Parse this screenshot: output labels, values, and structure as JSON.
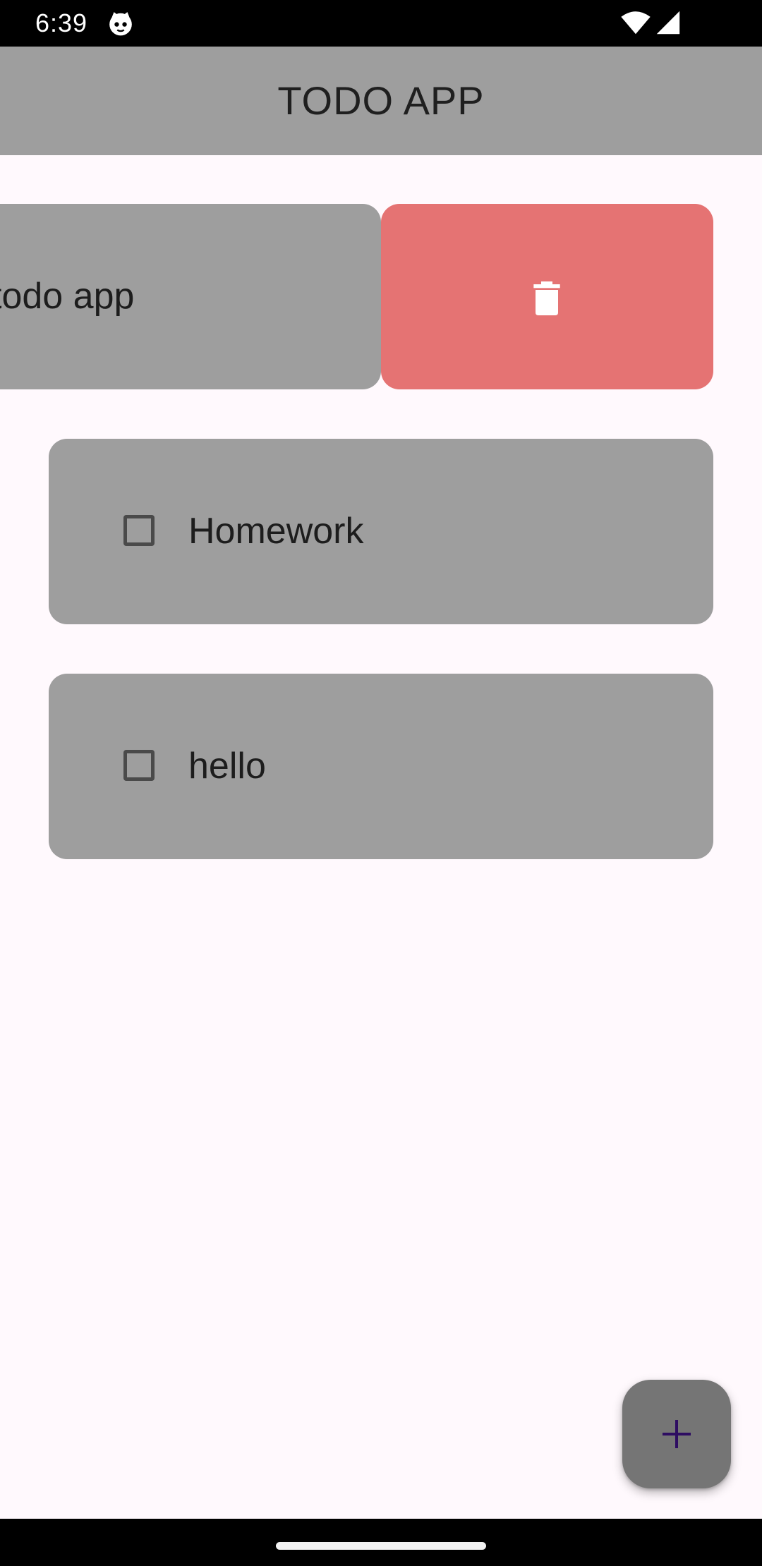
{
  "status_bar": {
    "time": "6:39",
    "icons": [
      "cat-icon",
      "wifi-icon",
      "signal-icon"
    ]
  },
  "app_bar": {
    "title": "TODO APP",
    "background": "#9E9E9E"
  },
  "todos": {
    "swiped": {
      "label": "todo app",
      "action_icon": "trash-icon",
      "action_color": "#E57373"
    },
    "items": [
      {
        "label": "Homework",
        "checked": false
      },
      {
        "label": "hello",
        "checked": false
      }
    ]
  },
  "fab": {
    "icon": "plus-icon",
    "background": "#757575"
  },
  "colors": {
    "page_background": "#FFF9FD",
    "card_background": "#9E9E9E",
    "delete": "#E57373",
    "fab_plus": "#2E0D62"
  }
}
